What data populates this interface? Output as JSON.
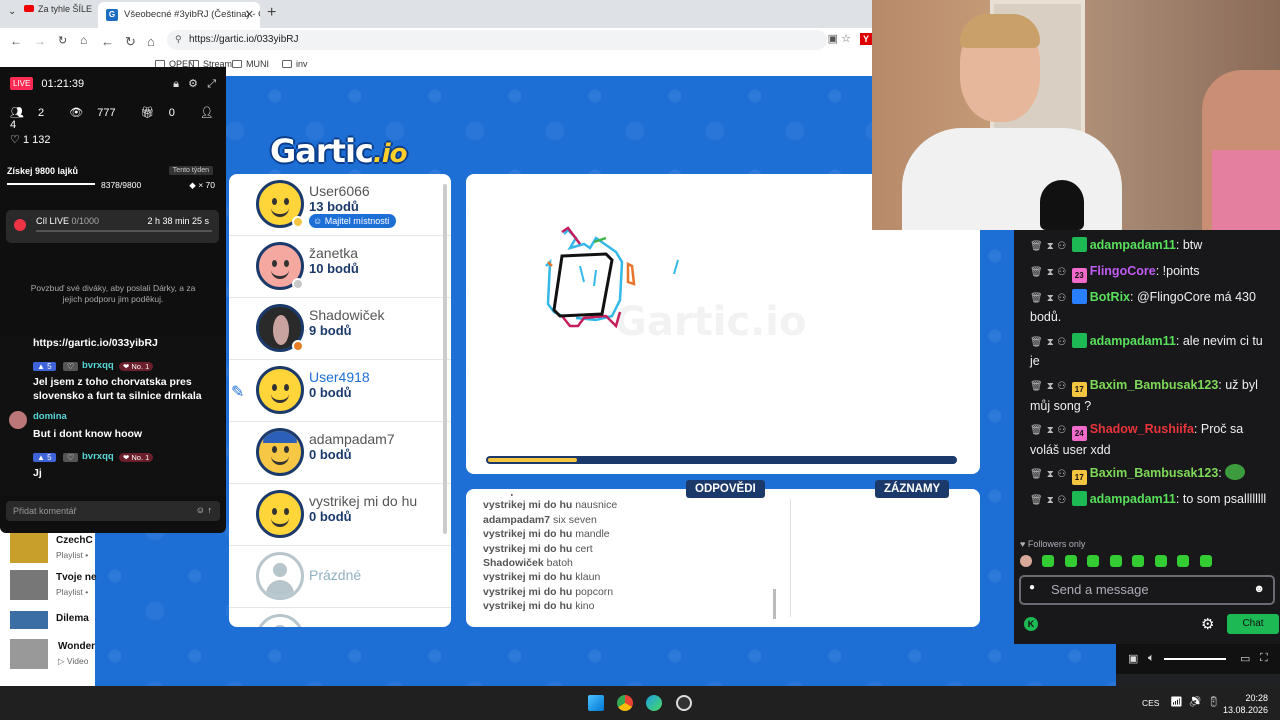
{
  "back_browser": {
    "tab_title": "Za tyhle ŠÍLE"
  },
  "browser": {
    "tab_title": "Všeobecné #3yibRJ (Čeština) - Gar",
    "url": "https://gartic.io/033yibRJ",
    "bookmarks": [
      "OPEN",
      "Stream",
      "MUNI",
      "inv"
    ]
  },
  "game": {
    "logo_main": "Gartic",
    "logo_suffix": ".io",
    "players": [
      {
        "name": "User6066",
        "points": "13 bodů",
        "badge": "Majitel místnosti",
        "status_color": "#f5c542"
      },
      {
        "name": "žanetka",
        "points": "10 bodů",
        "status_color": "#c8c8c8"
      },
      {
        "name": "Shadowiček",
        "points": "9 bodů",
        "status_color": "#e87d22"
      },
      {
        "name": "User4918",
        "points": "0 bodů",
        "drawing": true
      },
      {
        "name": "adampadam7",
        "points": "0 bodů"
      },
      {
        "name": "vystrikej mi do hu",
        "points": "0 bodů"
      },
      {
        "name": "Prázdné"
      }
    ],
    "canvas_watermark": "Gartic.io",
    "timer_progress": 0.19,
    "answers_tab": "ODPOVĚDI",
    "records_tab": "ZÁZNAMY",
    "answers": [
      {
        "user": "adampadam7",
        "text": "six seven"
      },
      {
        "user": "vystrikej mi do hu",
        "text": "nausnice"
      },
      {
        "user": "adampadam7",
        "text": "six seven"
      },
      {
        "user": "vystrikej mi do hu",
        "text": "mandle"
      },
      {
        "user": "vystrikej mi do hu",
        "text": "cert"
      },
      {
        "user": "Shadowiček",
        "text": "batoh"
      },
      {
        "user": "vystrikej mi do hu",
        "text": "klaun"
      },
      {
        "user": "vystrikej mi do hu",
        "text": "popcorn"
      },
      {
        "user": "vystrikej mi do hu",
        "text": "kino"
      }
    ]
  },
  "tiktok": {
    "live_label": "LIVE",
    "duration": "01:21:39",
    "stats": {
      "viewers": "2",
      "views": "777",
      "gifts": "0",
      "followers": "4"
    },
    "likes": "1 132",
    "goal_title": "Získej 9800 lajků",
    "goal_tag": "Tento týden",
    "goal_progress": "8378/9800",
    "goal_multiplier": "× 70",
    "card_left": "Cíl LIVE",
    "card_count": "0/1000",
    "card_time": "2 h 38 min 25 s",
    "promo": "Povzbuď své diváky, aby poslali Dárky, a za jejich podporu jim poděkuj.",
    "link_line": "https://gartic.io/033yibRJ",
    "chat": [
      {
        "level": "5",
        "user": "bvrxqq",
        "rank": "No. 1",
        "text": "Jel jsem z toho chorvatska pres slovensko a furt ta silnice drnkala"
      },
      {
        "user": "domina",
        "text": "But i dont know hoow"
      },
      {
        "level": "5",
        "user": "bvrxqq",
        "rank": "No. 1",
        "text": "Jj"
      }
    ],
    "input_placeholder": "Přidat komentář"
  },
  "youtube_list": [
    {
      "title": "CzechC",
      "sub": "Playlist •",
      "thumb": "#c89f2a"
    },
    {
      "title": "Tvoje ne",
      "sub": "Playlist •",
      "thumb": "#777"
    },
    {
      "title": "Dilema",
      "sub": "",
      "thumb": "#3a6ea5"
    },
    {
      "title": "Wonder",
      "sub": "Video",
      "thumb": "#999"
    }
  ],
  "twitch": {
    "messages": [
      {
        "badge": "#1db954",
        "badge_text": "",
        "user": "adampadam11",
        "user_color": "#58e05a",
        "text": "btw"
      },
      {
        "badge": "#f06acb",
        "badge_text": "23",
        "user": "FlingoCore",
        "user_color": "#c05cf2",
        "text": "!points"
      },
      {
        "badge": "#2a7fff",
        "badge_text": "",
        "user": "BotRix",
        "user_color": "#58e05a",
        "text": "@FlingoCore má 430 bodů."
      },
      {
        "badge": "#1db954",
        "badge_text": "",
        "user": "adampadam11",
        "user_color": "#58e05a",
        "text": "ale nevim ci tu je"
      },
      {
        "badge": "#f5c542",
        "badge_text": "17",
        "user": "Baxim_Bambusak123",
        "user_color": "#7ed957",
        "text": "už byl můj song ?"
      },
      {
        "badge": "#f06acb",
        "badge_text": "24",
        "user": "Shadow_Rushiifa",
        "user_color": "#e8343a",
        "text": "Proč sa voláš user xdd"
      },
      {
        "badge": "#f5c542",
        "badge_text": "17",
        "user": "Baxim_Bambusak123",
        "user_color": "#7ed957",
        "text": ""
      },
      {
        "badge": "#1db954",
        "badge_text": "",
        "user": "adampadam11",
        "user_color": "#58e05a",
        "text": "to som psallllllll"
      }
    ],
    "followers_only": "Followers only",
    "input_placeholder": "Send a message",
    "chat_button": "Chat"
  },
  "taskbar": {
    "lang": "CES",
    "time": "20:28",
    "date": "13.08.2026"
  }
}
